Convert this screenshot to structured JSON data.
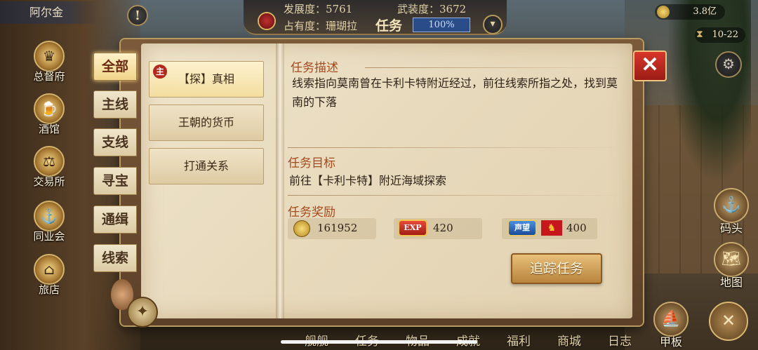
{
  "player": {
    "name": "阿尔金"
  },
  "stats": {
    "development": "发展度：5761",
    "armament": "武装度：3672",
    "occupancy": "占有度：珊瑚拉",
    "screen_title": "任务",
    "progress": "100%"
  },
  "resources": {
    "gold": "3.8亿",
    "date": "10-22"
  },
  "left_nav": [
    {
      "label": "总督府",
      "icon": "governor-icon"
    },
    {
      "label": "酒馆",
      "icon": "tavern-icon"
    },
    {
      "label": "交易所",
      "icon": "exchange-icon"
    },
    {
      "label": "同业会",
      "icon": "guild-icon"
    },
    {
      "label": "旅店",
      "icon": "inn-icon"
    }
  ],
  "right_nav": [
    {
      "label": "码头",
      "icon": "dock-icon"
    },
    {
      "label": "地图",
      "icon": "map-icon"
    },
    {
      "label": "甲板",
      "icon": "deck-icon"
    }
  ],
  "bottom_nav": [
    "舰舰",
    "任务",
    "物品",
    "成就",
    "福利",
    "商城",
    "日志"
  ],
  "categories": [
    "全部",
    "主线",
    "支线",
    "寻宝",
    "通缉",
    "线索"
  ],
  "tasks": [
    {
      "label": "【探】真相",
      "badge": "主"
    },
    {
      "label": "王朝的货币"
    },
    {
      "label": "打通关系"
    }
  ],
  "detail": {
    "desc_title": "任务描述",
    "desc": "线索指向莫南曾在卡利卡特附近经过，前往线索所指之处，找到莫南的下落",
    "goal_title": "任务目标",
    "goal": "前往【卡利卡特】附近海域探索",
    "reward_title": "任务奖励",
    "rewards": {
      "gold": "161952",
      "exp_label": "EXP",
      "exp": "420",
      "fame_label": "声望",
      "fame": "400"
    },
    "track_button": "追踪任务"
  },
  "colors": {
    "accent": "#a34a1e",
    "close": "#c82a20",
    "progress": "#2a4c88"
  }
}
